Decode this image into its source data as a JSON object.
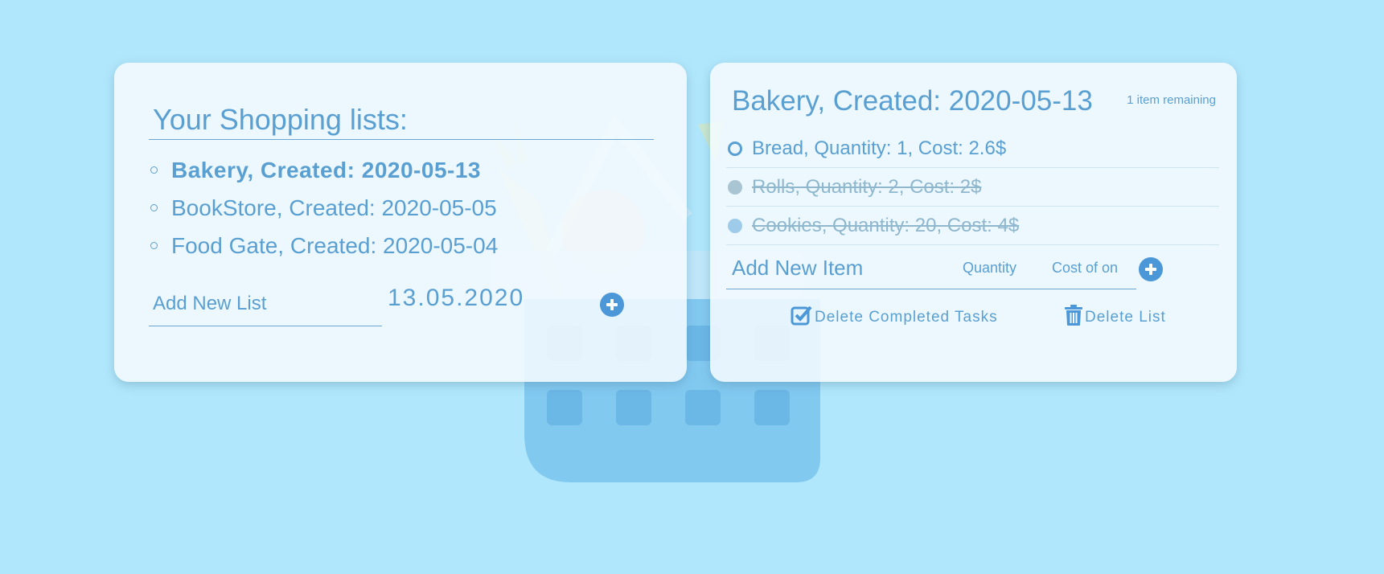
{
  "colors": {
    "background": "#b1e7fc",
    "card": "#f4fbfe",
    "text": "#5a9fd1",
    "accent": "#4c97d8",
    "done_text": "#8fb7ce"
  },
  "lists_panel": {
    "title": "Your Shopping lists:",
    "lists": [
      {
        "label": "Bakery, Created: 2020-05-13",
        "active": true
      },
      {
        "label": "BookStore, Created: 2020-05-05",
        "active": false
      },
      {
        "label": "Food Gate, Created: 2020-05-04",
        "active": false
      }
    ],
    "new_list_placeholder": "Add New List",
    "date_value": "13.05.2020",
    "add_icon": "plus-circle-icon"
  },
  "detail_panel": {
    "title": "Bakery, Created: 2020-05-13",
    "remaining": "1 item remaining",
    "items": [
      {
        "label": "Bread, Quantity: 1, Cost: 2.6$",
        "completed": false
      },
      {
        "label": "Rolls, Quantity: 2, Cost: 2$",
        "completed": true
      },
      {
        "label": "Cookies, Quantity: 20, Cost: 4$",
        "completed": true
      }
    ],
    "new_item_placeholder": "Add New Item",
    "quantity_placeholder": "Quantity",
    "cost_placeholder": "Cost of on",
    "add_icon": "plus-circle-icon",
    "delete_completed_label": "Delete Completed Tasks",
    "delete_completed_icon": "checkbox-checked-icon",
    "delete_list_label": "Delete List",
    "delete_list_icon": "trash-icon"
  }
}
